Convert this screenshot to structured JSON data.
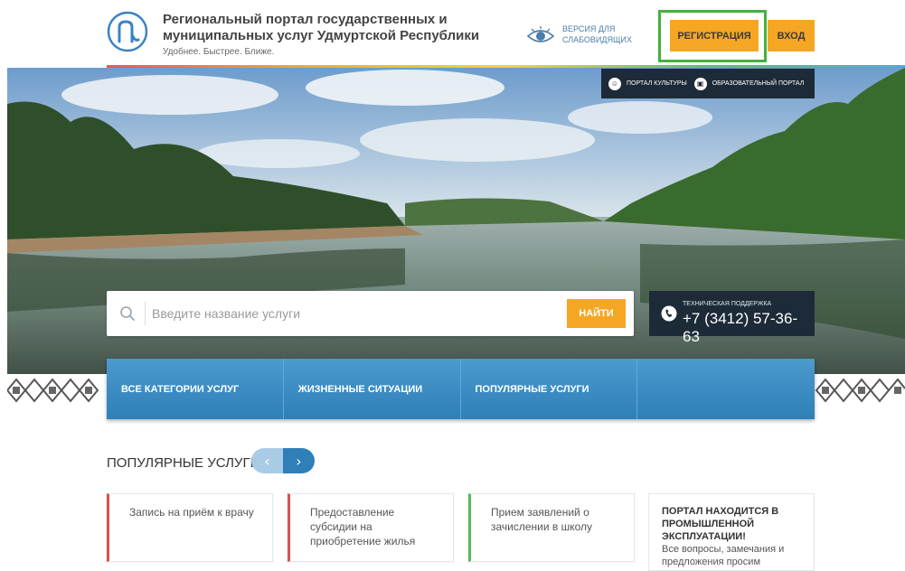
{
  "header": {
    "title": "Региональный портал государственных и муниципальных услуг Удмуртской Республики",
    "slogan": "Удобнее. Быстрее. Ближе.",
    "vision_label": "ВЕРСИЯ ДЛЯ СЛАБОВИДЯЩИХ",
    "register_label": "РЕГИСТРАЦИЯ",
    "login_label": "ВХОД"
  },
  "quicklinks": [
    {
      "label": "ПОРТАЛ КУЛЬТУРЫ",
      "icon": "culture-icon"
    },
    {
      "label": "ОБРАЗОВАТЕЛЬНЫЙ ПОРТАЛ",
      "icon": "education-icon"
    }
  ],
  "search": {
    "placeholder": "Введите название услуги",
    "button_label": "НАЙТИ"
  },
  "support": {
    "label": "ТЕХНИЧЕСКАЯ ПОДДЕРЖКА",
    "phone": "+7 (3412) 57-36-63"
  },
  "categories": [
    {
      "label": "ВСЕ КАТЕГОРИИ УСЛУГ"
    },
    {
      "label": "ЖИЗНЕННЫЕ СИТУАЦИИ"
    },
    {
      "label": "ПОПУЛЯРНЫЕ УСЛУГИ"
    },
    {
      "label": ""
    }
  ],
  "popular": {
    "title": "ПОПУЛЯРНЫЕ УСЛУГИ",
    "cards": [
      {
        "text": "Запись на приём к врачу",
        "accent": "#d9534f"
      },
      {
        "text": "Предоставление субсидии на приобретение жилья",
        "accent": "#d9534f"
      },
      {
        "text": "Прием заявлений о зачислении в школу",
        "accent": "#5cb85c"
      }
    ],
    "notice": {
      "title": "ПОРТАЛ НАХОДИТСЯ В ПРОМЫШЛЕННОЙ ЭКСПЛУАТАЦИИ!",
      "text": "Все вопросы, замечания и предложения просим"
    }
  },
  "colors": {
    "accent_orange": "#f5a623",
    "nav_blue": "#2f7fb8",
    "dark_panel": "#1d2b38",
    "highlight_green": "#45b13c"
  }
}
